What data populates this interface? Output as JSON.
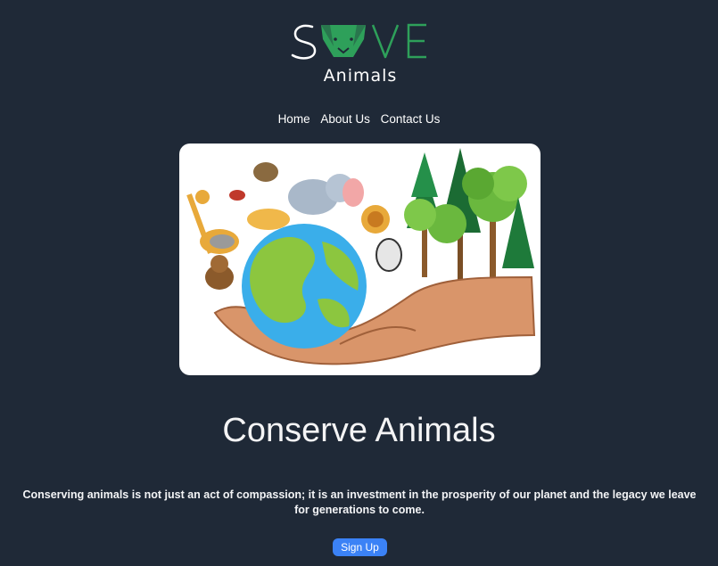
{
  "logo": {
    "word": "SAVE",
    "sub": "Animals"
  },
  "nav": {
    "items": [
      "Home",
      "About Us",
      "Contact Us"
    ]
  },
  "hero": {
    "illustration": "hands-holding-globe-with-animals-and-trees"
  },
  "title": "Conserve Animals",
  "description": "Conserving animals is not just an act of compassion; it is an investment in the prosperity of our planet and the legacy we leave for generations to come.",
  "cta": {
    "label": "Sign Up"
  },
  "colors": {
    "background": "#1f2937",
    "logo_green": "#2ea05a",
    "button": "#3b82f6"
  }
}
